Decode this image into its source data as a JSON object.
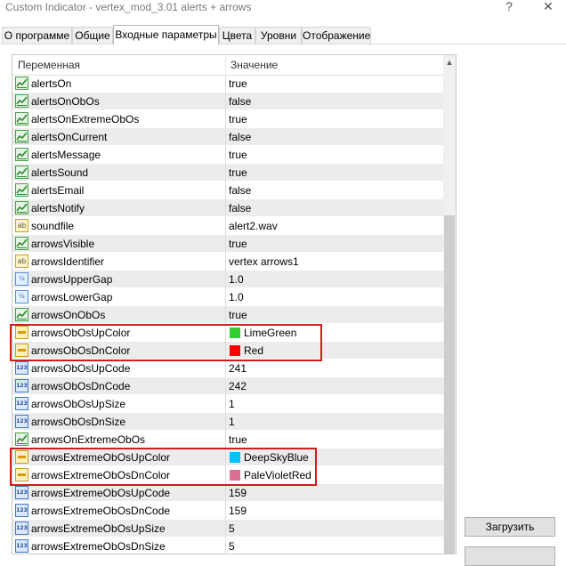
{
  "window": {
    "title": "Custom Indicator - vertex_mod_3.01 alerts + arrows",
    "help_label": "?",
    "close_label": "✕"
  },
  "tabs": [
    {
      "label": "О программе"
    },
    {
      "label": "Общие"
    },
    {
      "label": "Входные параметры"
    },
    {
      "label": "Цвета"
    },
    {
      "label": "Уровни"
    },
    {
      "label": "Отображение"
    }
  ],
  "active_tab": "Входные параметры",
  "grid": {
    "col_variable": "Переменная",
    "col_value": "Значение",
    "rows": [
      {
        "name": "alertsOn",
        "value": "true",
        "type": "bool"
      },
      {
        "name": "alertsOnObOs",
        "value": "false",
        "type": "bool"
      },
      {
        "name": "alertsOnExtremeObOs",
        "value": "true",
        "type": "bool"
      },
      {
        "name": "alertsOnCurrent",
        "value": "false",
        "type": "bool"
      },
      {
        "name": "alertsMessage",
        "value": "true",
        "type": "bool"
      },
      {
        "name": "alertsSound",
        "value": "true",
        "type": "bool"
      },
      {
        "name": "alertsEmail",
        "value": "false",
        "type": "bool"
      },
      {
        "name": "alertsNotify",
        "value": "false",
        "type": "bool"
      },
      {
        "name": "soundfile",
        "value": "alert2.wav",
        "type": "string"
      },
      {
        "name": "arrowsVisible",
        "value": "true",
        "type": "bool"
      },
      {
        "name": "arrowsIdentifier",
        "value": "vertex arrows1",
        "type": "string"
      },
      {
        "name": "arrowsUpperGap",
        "value": "1.0",
        "type": "double"
      },
      {
        "name": "arrowsLowerGap",
        "value": "1.0",
        "type": "double"
      },
      {
        "name": "arrowsOnObOs",
        "value": "true",
        "type": "bool"
      },
      {
        "name": "arrowsObOsUpColor",
        "value": "LimeGreen",
        "type": "color",
        "color": "#32cd32"
      },
      {
        "name": "arrowsObOsDnColor",
        "value": "Red",
        "type": "color",
        "color": "#ff0000"
      },
      {
        "name": "arrowsObOsUpCode",
        "value": "241",
        "type": "int"
      },
      {
        "name": "arrowsObOsDnCode",
        "value": "242",
        "type": "int"
      },
      {
        "name": "arrowsObOsUpSize",
        "value": "1",
        "type": "int"
      },
      {
        "name": "arrowsObOsDnSize",
        "value": "1",
        "type": "int"
      },
      {
        "name": "arrowsOnExtremeObOs",
        "value": "true",
        "type": "bool"
      },
      {
        "name": "arrowsExtremeObOsUpColor",
        "value": "DeepSkyBlue",
        "type": "color",
        "color": "#00bfff"
      },
      {
        "name": "arrowsExtremeObOsDnColor",
        "value": "PaleVioletRed",
        "type": "color",
        "color": "#db7093"
      },
      {
        "name": "arrowsExtremeObOsUpCode",
        "value": "159",
        "type": "int"
      },
      {
        "name": "arrowsExtremeObOsDnCode",
        "value": "159",
        "type": "int"
      },
      {
        "name": "arrowsExtremeObOsUpSize",
        "value": "5",
        "type": "int"
      },
      {
        "name": "arrowsExtremeObOsDnSize",
        "value": "5",
        "type": "int"
      }
    ]
  },
  "icons": {
    "bool": "bool-param-icon",
    "string": "string-param-icon",
    "double": "double-param-icon",
    "int": "int-param-icon",
    "color": "color-param-icon"
  },
  "icon_text": {
    "string": "ab",
    "double": "½",
    "int": "123"
  },
  "highlight_color": "#d21b1b",
  "buttons": {
    "load_label": "Загрузить"
  }
}
